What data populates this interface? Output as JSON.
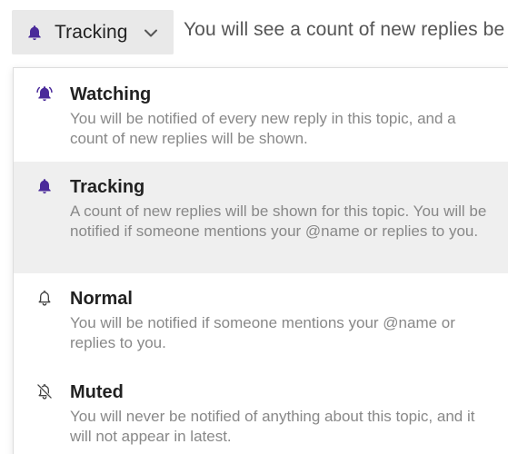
{
  "trigger": {
    "label": "Tracking",
    "icon": "bell-icon",
    "chevron": "chevron-down-icon"
  },
  "status_text": "You will see a count of new replies be",
  "accent_color": "#4a2a9a",
  "menu": {
    "items": [
      {
        "title": "Watching",
        "description": "You will be notified of every new reply in this topic, and a count of new replies will be shown.",
        "icon": "bell-filled-icon",
        "selected": false
      },
      {
        "title": "Tracking",
        "description": "A count of new replies will be shown for this topic. You will be notified if someone mentions your @name or replies to you.",
        "icon": "bell-filled-icon",
        "selected": true
      },
      {
        "title": "Normal",
        "description": "You will be notified if someone mentions your @name or replies to you.",
        "icon": "bell-outline-icon",
        "selected": false
      },
      {
        "title": "Muted",
        "description": "You will never be notified of anything about this topic, and it will not appear in latest.",
        "icon": "bell-slash-icon",
        "selected": false
      }
    ]
  }
}
